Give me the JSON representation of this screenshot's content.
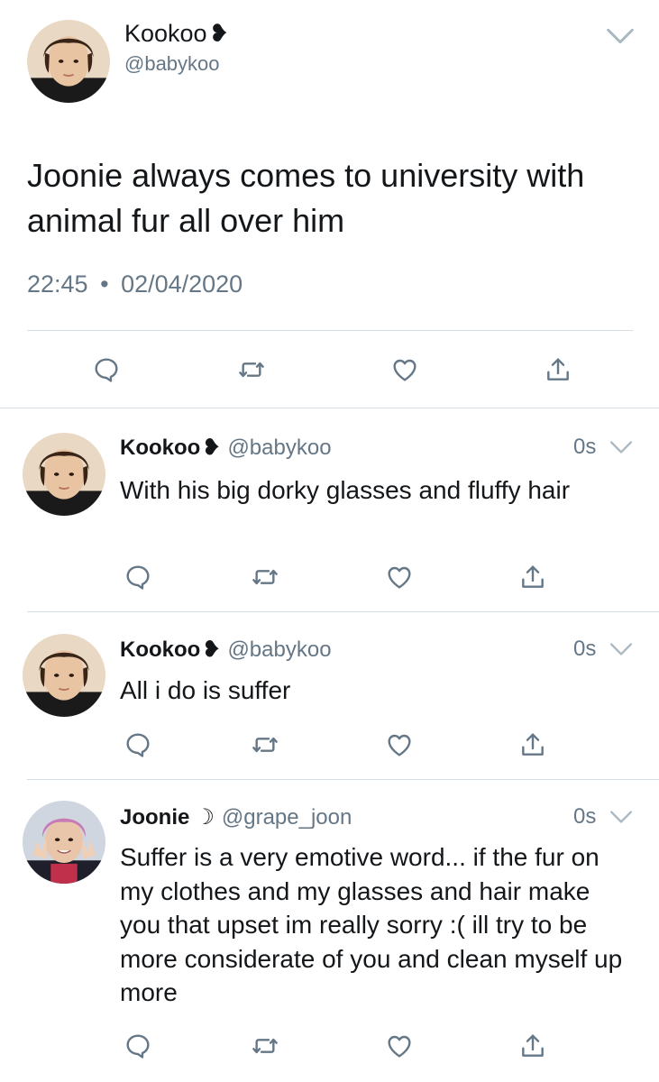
{
  "main_tweet": {
    "display_name": "Kookoo",
    "name_glyph": "❥",
    "handle": "@babykoo",
    "text": "Joonie always comes to university with animal fur all over him",
    "time": "22:45",
    "separator": "•",
    "date": "02/04/2020",
    "icons": [
      "reply-icon",
      "retweet-icon",
      "like-icon",
      "share-icon"
    ]
  },
  "replies": [
    {
      "display_name": "Kookoo",
      "name_glyph": "❥",
      "handle": "@babykoo",
      "time": "0s",
      "text": "With his big dorky glasses and fluffy hair"
    },
    {
      "display_name": "Kookoo",
      "name_glyph": "❥",
      "handle": "@babykoo",
      "time": "0s",
      "text": "All i do is suffer"
    },
    {
      "display_name": "Joonie",
      "name_glyph": "☽",
      "handle": "@grape_joon",
      "time": "0s",
      "text": "Suffer is a very emotive word... if the fur on my clothes and my glasses and hair make you that upset im really sorry :( ill try to be more considerate of you and clean myself up more"
    }
  ],
  "colors": {
    "text_primary": "#14171a",
    "text_secondary": "#657786",
    "divider": "#d6dde2",
    "icon": "#657786"
  }
}
